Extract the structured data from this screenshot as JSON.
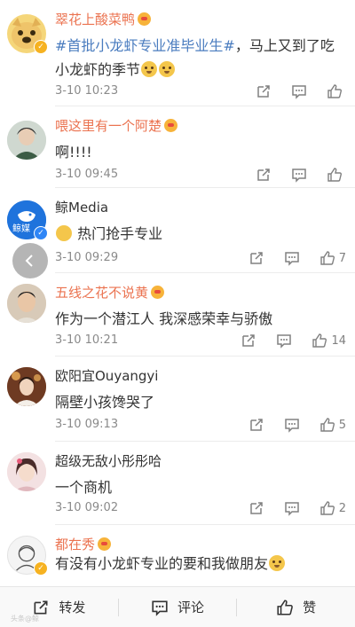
{
  "comments": [
    {
      "name": "翠花上酸菜鸭",
      "hashtag": "#首批小龙虾专业准毕业生#",
      "text": "，马上又到了吃小龙虾的季节",
      "time": "3-10 10:23",
      "like_count": ""
    },
    {
      "name": "喂这里有一个阿楚",
      "text": "啊!!!!",
      "time": "3-10 09:45",
      "like_count": ""
    },
    {
      "name": "鲸Media",
      "avatar_text": "鲸媒",
      "text": "热门抢手专业",
      "time": "3-10 09:29",
      "like_count": "7"
    },
    {
      "name": "五线之花不说黄",
      "text": "作为一个潜江人 我深感荣幸与骄傲",
      "time": "3-10 10:21",
      "like_count": "14"
    },
    {
      "name": "欧阳宜Ouyangyi",
      "text": "隔壁小孩馋哭了",
      "time": "3-10 09:13",
      "like_count": "5"
    },
    {
      "name": "超级无敌小彤彤哈",
      "text": "一个商机",
      "time": "3-10 09:02",
      "like_count": "2"
    },
    {
      "name": "都在秀",
      "text": "有没有小龙虾专业的要和我做朋友",
      "time": "",
      "like_count": ""
    }
  ],
  "bottom_bar": {
    "repost_label": "转发",
    "comment_label": "评论",
    "like_label": "赞"
  },
  "watermark": "头条@鲸",
  "colors": {
    "vip_name": "#eb7350",
    "hashtag": "#4a7cbf",
    "meta": "#8a8a8a"
  },
  "icons": [
    "share-icon",
    "comment-icon",
    "thumbs-up-icon",
    "back-arrow-icon",
    "verified-badge-icon"
  ]
}
